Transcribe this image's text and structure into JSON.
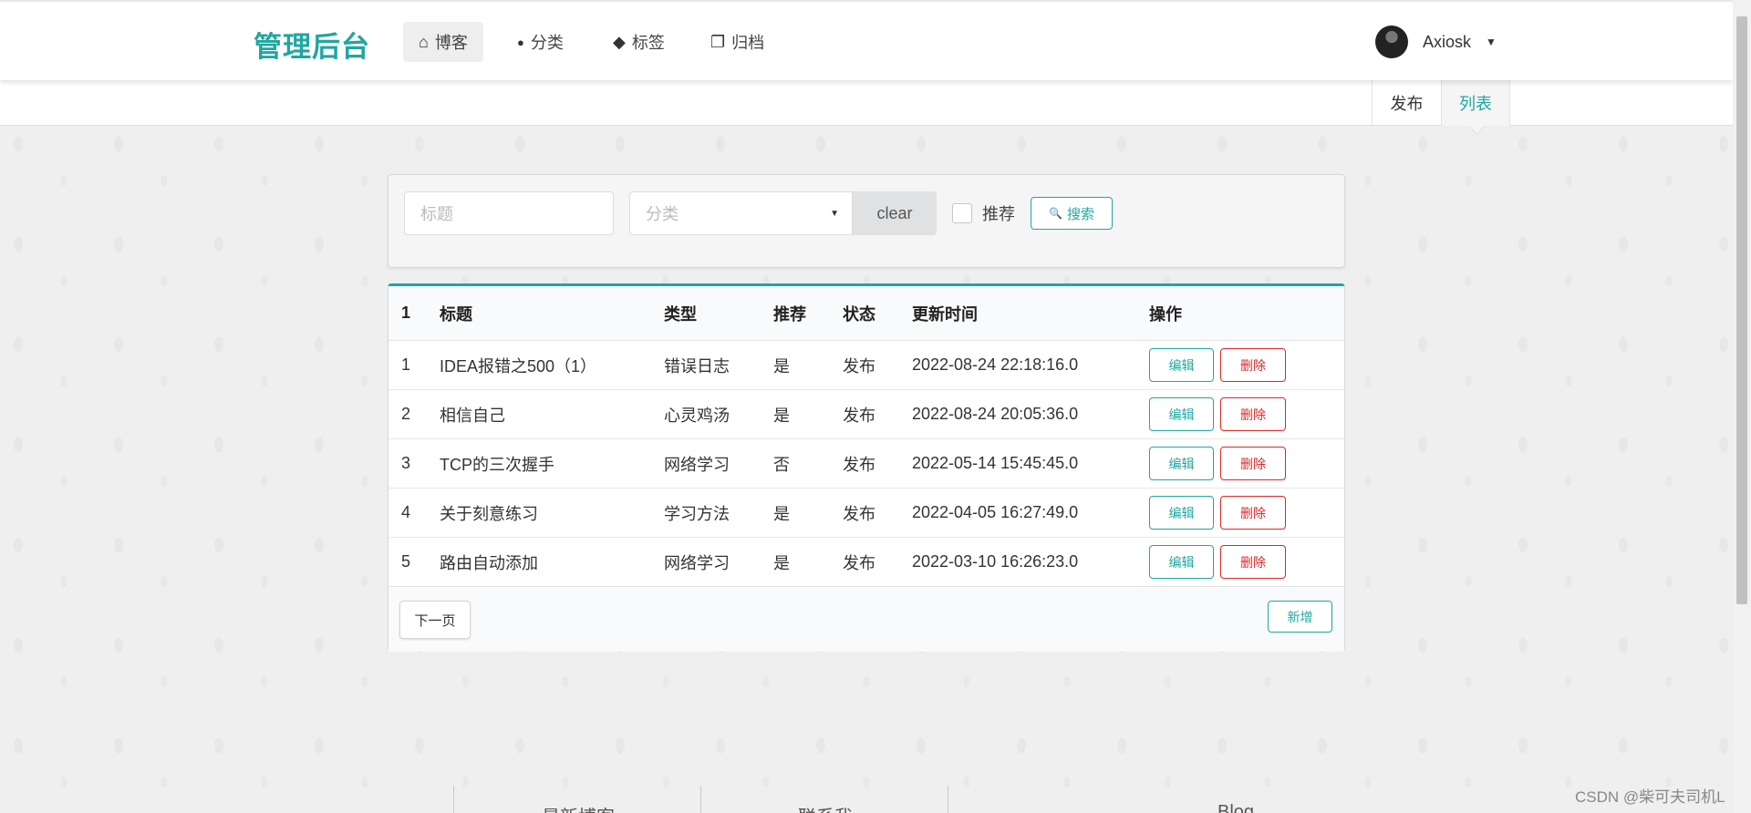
{
  "nav": {
    "brand": "管理后台",
    "items": [
      {
        "label": "博客",
        "icon": "home-icon",
        "glyph": "⌂",
        "active": true
      },
      {
        "label": "分类",
        "icon": "lightbulb-icon",
        "glyph": "●",
        "active": false
      },
      {
        "label": "标签",
        "icon": "tags-icon",
        "glyph": "◆",
        "active": false
      },
      {
        "label": "归档",
        "icon": "clone-icon",
        "glyph": "❐",
        "active": false
      }
    ],
    "user": {
      "name": "Axiosk",
      "caret": "▼"
    }
  },
  "subnav": {
    "publish": "发布",
    "list": "列表"
  },
  "search": {
    "title_placeholder": "标题",
    "category_placeholder": "分类",
    "category_caret": "▼",
    "clear_label": "clear",
    "recommend_label": "推荐",
    "search_label": "搜索",
    "search_icon": "🔍"
  },
  "table": {
    "headers": [
      "1",
      "标题",
      "类型",
      "推荐",
      "状态",
      "更新时间",
      "操作"
    ],
    "rows": [
      {
        "id": "1",
        "title": "IDEA报错之500（1）",
        "type": "错误日志",
        "recommend": "是",
        "status": "发布",
        "updated": "2022-08-24 22:18:16.0"
      },
      {
        "id": "2",
        "title": "相信自己",
        "type": "心灵鸡汤",
        "recommend": "是",
        "status": "发布",
        "updated": "2022-08-24 20:05:36.0"
      },
      {
        "id": "3",
        "title": "TCP的三次握手",
        "type": "网络学习",
        "recommend": "否",
        "status": "发布",
        "updated": "2022-05-14 15:45:45.0"
      },
      {
        "id": "4",
        "title": "关于刻意练习",
        "type": "学习方法",
        "recommend": "是",
        "status": "发布",
        "updated": "2022-04-05 16:27:49.0"
      },
      {
        "id": "5",
        "title": "路由自动添加",
        "type": "网络学习",
        "recommend": "是",
        "status": "发布",
        "updated": "2022-03-10 16:26:23.0"
      }
    ],
    "edit_label": "编辑",
    "delete_label": "删除",
    "next_label": "下一页",
    "add_label": "新增"
  },
  "footer": {
    "latest": "最新博客",
    "contact": "联系我",
    "blog": "Blog"
  },
  "watermark": "CSDN @柴可夫司机L",
  "colors": {
    "accent": "#1fa7a0",
    "danger": "#db2828"
  }
}
